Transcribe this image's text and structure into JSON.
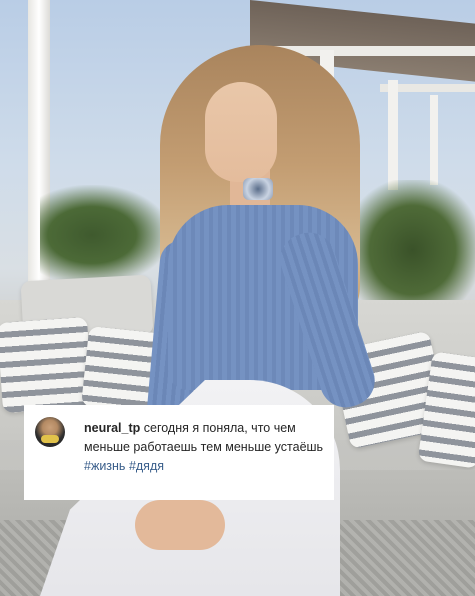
{
  "comment": {
    "username": "neural_tp",
    "text": "сегодня я поняла, что чем меньше работаешь тем меньше устаёшь",
    "tags": [
      "#жизнь",
      "#дядя"
    ]
  },
  "colors": {
    "card_background": "#ffffff",
    "text": "#262626",
    "hashtag": "#385d8a"
  },
  "icons": {
    "avatar": "user-avatar-photo"
  }
}
